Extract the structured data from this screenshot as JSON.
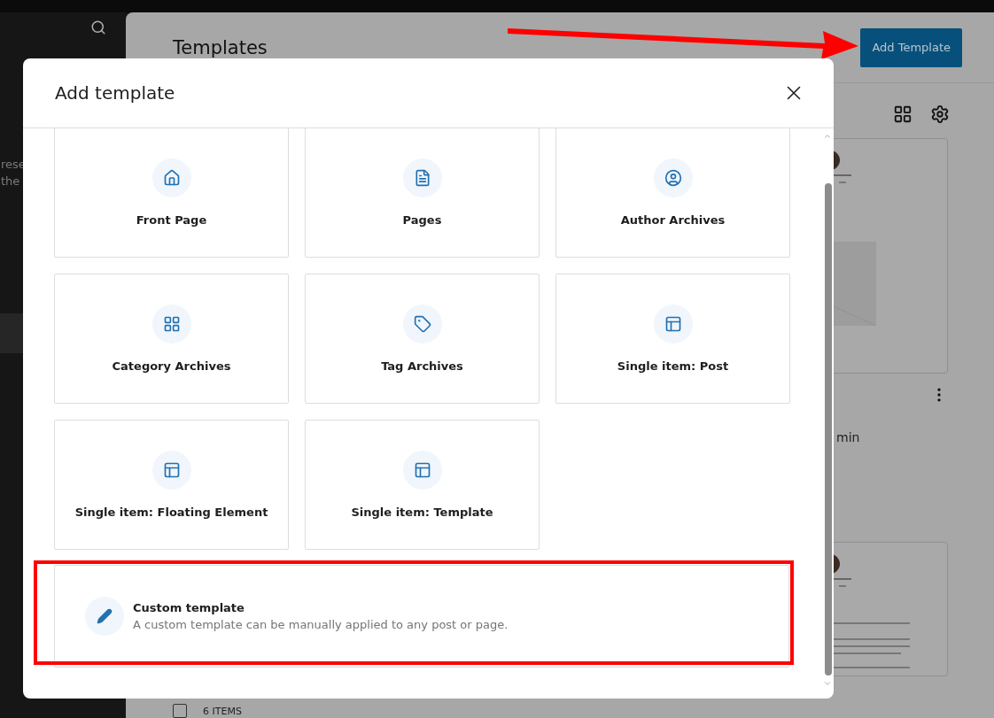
{
  "sidebar": {
    "texts": [
      "rese",
      "the"
    ],
    "items": [
      {
        "selected": true
      }
    ]
  },
  "page": {
    "title": "Templates",
    "add_button": "Add Template",
    "author_fragment": "min",
    "footer_count": "6 ITEMS",
    "select_all": {
      "checked": false
    }
  },
  "dialog": {
    "title": "Add template",
    "templates": [
      {
        "label": "Front Page"
      },
      {
        "label": "Pages"
      },
      {
        "label": "Author Archives"
      },
      {
        "label": "Category Archives"
      },
      {
        "label": "Tag Archives"
      },
      {
        "label": "Single item: Post"
      },
      {
        "label": "Single item: Floating Element"
      },
      {
        "label": "Single item: Template"
      }
    ],
    "custom": {
      "title": "Custom template",
      "description": "A custom template can be manually applied to any post or page."
    }
  }
}
